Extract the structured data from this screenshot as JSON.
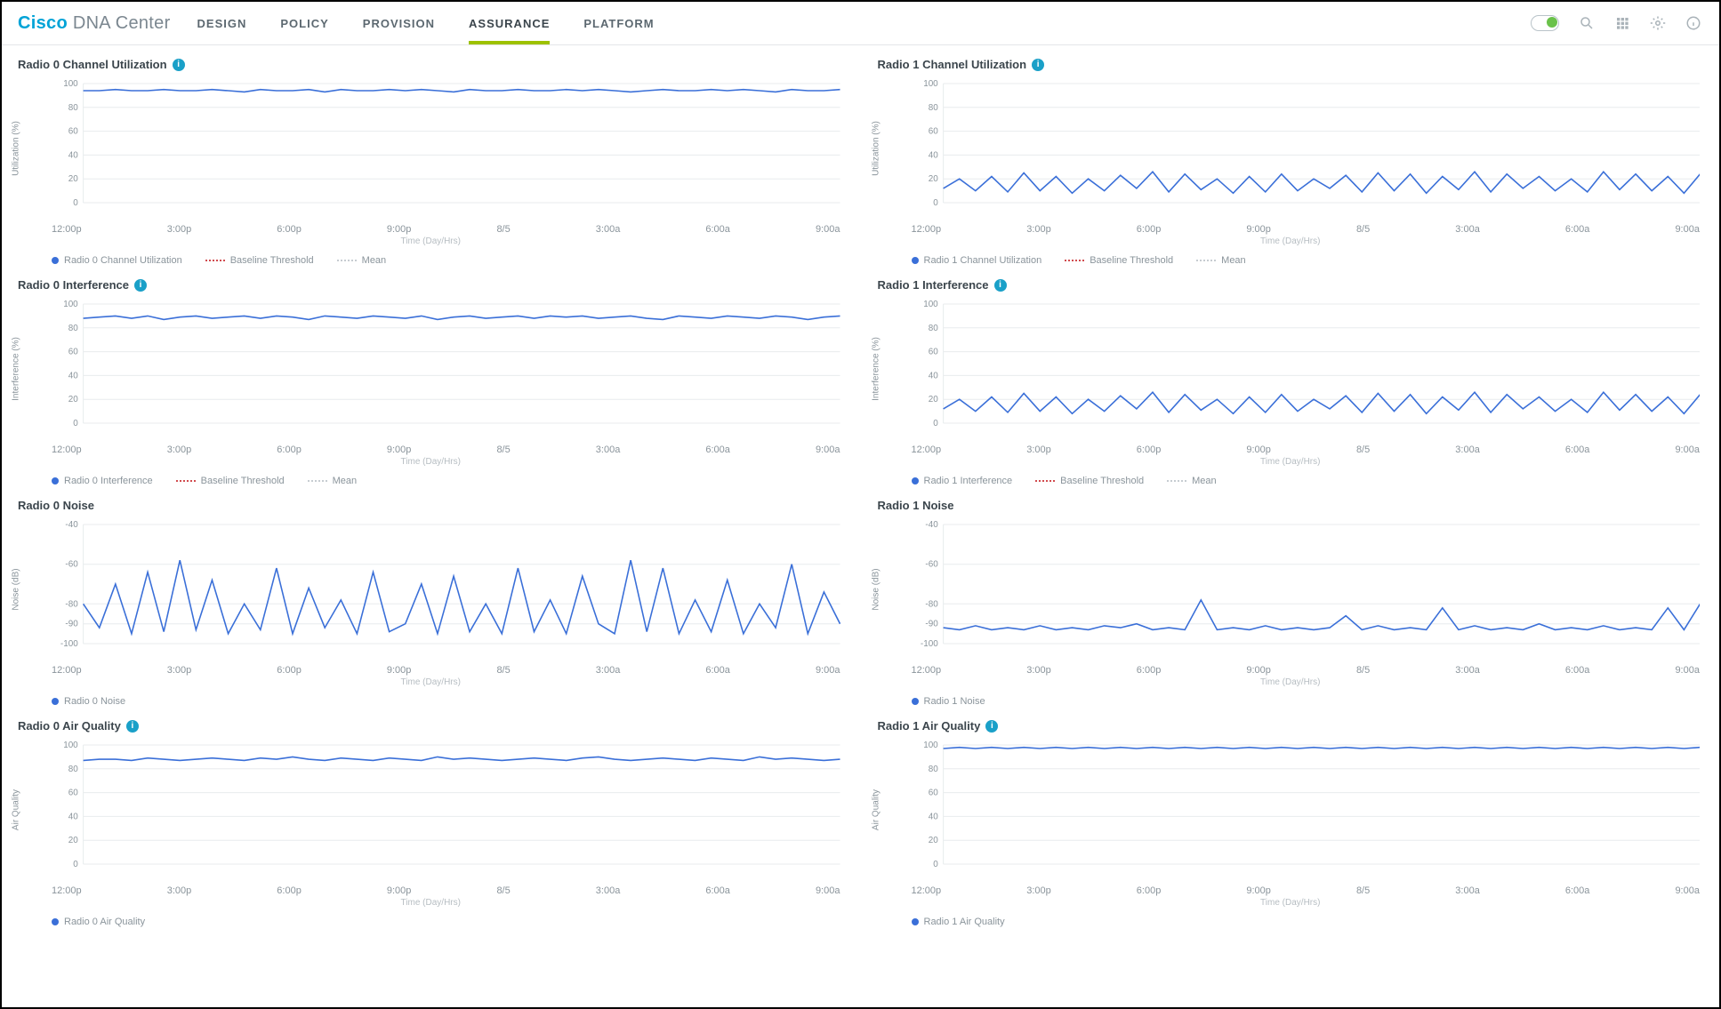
{
  "brand": {
    "cisco": "Cisco",
    "dna": " DNA Center"
  },
  "nav": [
    "DESIGN",
    "POLICY",
    "PROVISION",
    "ASSURANCE",
    "PLATFORM"
  ],
  "nav_active": 3,
  "xcats": [
    "12:00p",
    "3:00p",
    "6:00p",
    "9:00p",
    "8/5",
    "3:00a",
    "6:00a",
    "9:00a"
  ],
  "xaxis_title": "Time (Day/Hrs)",
  "legend": {
    "series": "",
    "baseline": "Baseline Threshold",
    "mean": "Mean"
  },
  "panels": [
    {
      "id": "r0-chan",
      "title": "Radio 0 Channel Utilization",
      "info": true,
      "ylabel": "Utilization (%)",
      "ylim": [
        0,
        100
      ],
      "legend_full": true,
      "series_name": "Radio 0 Channel Utilization"
    },
    {
      "id": "r1-chan",
      "title": "Radio 1 Channel Utilization",
      "info": true,
      "ylabel": "Utilization (%)",
      "ylim": [
        0,
        100
      ],
      "legend_full": true,
      "series_name": "Radio 1 Channel Utilization"
    },
    {
      "id": "r0-intf",
      "title": "Radio 0 Interference",
      "info": true,
      "ylabel": "Interference (%)",
      "ylim": [
        0,
        100
      ],
      "legend_full": true,
      "series_name": "Radio 0 Interference"
    },
    {
      "id": "r1-intf",
      "title": "Radio 1 Interference",
      "info": true,
      "ylabel": "Interference (%)",
      "ylim": [
        0,
        100
      ],
      "legend_full": true,
      "series_name": "Radio 1 Interference"
    },
    {
      "id": "r0-noise",
      "title": "Radio 0 Noise",
      "info": false,
      "ylabel": "Noise (dB)",
      "ylim": [
        -100,
        -40
      ],
      "legend_full": false,
      "series_name": "Radio 0 Noise"
    },
    {
      "id": "r1-noise",
      "title": "Radio 1 Noise",
      "info": false,
      "ylabel": "Noise (dB)",
      "ylim": [
        -100,
        -40
      ],
      "legend_full": false,
      "series_name": "Radio 1 Noise"
    },
    {
      "id": "r0-airq",
      "title": "Radio 0 Air Quality",
      "info": true,
      "ylabel": "Air Quality",
      "ylim": [
        0,
        100
      ],
      "legend_full": false,
      "series_name": "Radio 0 Air Quality"
    },
    {
      "id": "r1-airq",
      "title": "Radio 1 Air Quality",
      "info": true,
      "ylabel": "Air Quality",
      "ylim": [
        0,
        100
      ],
      "legend_full": false,
      "series_name": "Radio 1 Air Quality"
    }
  ],
  "chart_data": [
    {
      "panel": "r0-chan",
      "type": "line",
      "xlabel": "Time (Day/Hrs)",
      "ylabel": "Utilization (%)",
      "ylim": [
        0,
        100
      ],
      "yticks": [
        0,
        20,
        40,
        60,
        80,
        100
      ],
      "values": [
        94,
        94,
        95,
        94,
        94,
        95,
        94,
        94,
        95,
        94,
        93,
        95,
        94,
        94,
        95,
        93,
        95,
        94,
        94,
        95,
        94,
        95,
        94,
        93,
        95,
        94,
        94,
        95,
        94,
        94,
        95,
        94,
        95,
        94,
        93,
        94,
        95,
        94,
        94,
        95,
        94,
        95,
        94,
        93,
        95,
        94,
        94,
        95
      ]
    },
    {
      "panel": "r1-chan",
      "type": "line",
      "xlabel": "Time (Day/Hrs)",
      "ylabel": "Utilization (%)",
      "ylim": [
        0,
        100
      ],
      "yticks": [
        0,
        20,
        40,
        60,
        80,
        100
      ],
      "values": [
        12,
        20,
        10,
        22,
        9,
        25,
        10,
        22,
        8,
        20,
        10,
        23,
        12,
        26,
        9,
        24,
        11,
        20,
        8,
        22,
        9,
        24,
        10,
        20,
        12,
        23,
        9,
        25,
        10,
        24,
        8,
        22,
        11,
        26,
        9,
        24,
        12,
        22,
        10,
        20,
        9,
        26,
        11,
        24,
        10,
        22,
        8,
        24
      ]
    },
    {
      "panel": "r0-intf",
      "type": "line",
      "xlabel": "Time (Day/Hrs)",
      "ylabel": "Interference (%)",
      "ylim": [
        0,
        100
      ],
      "yticks": [
        0,
        20,
        40,
        60,
        80,
        100
      ],
      "values": [
        88,
        89,
        90,
        88,
        90,
        87,
        89,
        90,
        88,
        89,
        90,
        88,
        90,
        89,
        87,
        90,
        89,
        88,
        90,
        89,
        88,
        90,
        87,
        89,
        90,
        88,
        89,
        90,
        88,
        90,
        89,
        90,
        88,
        89,
        90,
        88,
        87,
        90,
        89,
        88,
        90,
        89,
        88,
        90,
        89,
        87,
        89,
        90
      ]
    },
    {
      "panel": "r1-intf",
      "type": "line",
      "xlabel": "Time (Day/Hrs)",
      "ylabel": "Interference (%)",
      "ylim": [
        0,
        100
      ],
      "yticks": [
        0,
        20,
        40,
        60,
        80,
        100
      ],
      "values": [
        12,
        20,
        10,
        22,
        9,
        25,
        10,
        22,
        8,
        20,
        10,
        23,
        12,
        26,
        9,
        24,
        11,
        20,
        8,
        22,
        9,
        24,
        10,
        20,
        12,
        23,
        9,
        25,
        10,
        24,
        8,
        22,
        11,
        26,
        9,
        24,
        12,
        22,
        10,
        20,
        9,
        26,
        11,
        24,
        10,
        22,
        8,
        24
      ]
    },
    {
      "panel": "r0-noise",
      "type": "line",
      "xlabel": "Time (Day/Hrs)",
      "ylabel": "Noise (dB)",
      "ylim": [
        -100,
        -40
      ],
      "yticks": [
        -100,
        -90,
        -80,
        -60,
        -40
      ],
      "values": [
        -80,
        -92,
        -70,
        -95,
        -64,
        -94,
        -58,
        -93,
        -68,
        -95,
        -80,
        -93,
        -62,
        -95,
        -72,
        -92,
        -78,
        -95,
        -64,
        -94,
        -90,
        -70,
        -95,
        -66,
        -94,
        -80,
        -95,
        -62,
        -94,
        -78,
        -95,
        -66,
        -90,
        -95,
        -58,
        -94,
        -62,
        -95,
        -78,
        -94,
        -68,
        -95,
        -80,
        -92,
        -60,
        -95,
        -74,
        -90
      ]
    },
    {
      "panel": "r1-noise",
      "type": "line",
      "xlabel": "Time (Day/Hrs)",
      "ylabel": "Noise (dB)",
      "ylim": [
        -100,
        -40
      ],
      "yticks": [
        -100,
        -90,
        -80,
        -60,
        -40
      ],
      "values": [
        -92,
        -93,
        -91,
        -93,
        -92,
        -93,
        -91,
        -93,
        -92,
        -93,
        -91,
        -92,
        -90,
        -93,
        -92,
        -93,
        -78,
        -93,
        -92,
        -93,
        -91,
        -93,
        -92,
        -93,
        -92,
        -86,
        -93,
        -91,
        -93,
        -92,
        -93,
        -82,
        -93,
        -91,
        -93,
        -92,
        -93,
        -90,
        -93,
        -92,
        -93,
        -91,
        -93,
        -92,
        -93,
        -82,
        -93,
        -80
      ]
    },
    {
      "panel": "r0-airq",
      "type": "line",
      "xlabel": "Time (Day/Hrs)",
      "ylabel": "Air Quality",
      "ylim": [
        0,
        100
      ],
      "yticks": [
        0,
        20,
        40,
        60,
        80,
        100
      ],
      "values": [
        87,
        88,
        88,
        87,
        89,
        88,
        87,
        88,
        89,
        88,
        87,
        89,
        88,
        90,
        88,
        87,
        89,
        88,
        87,
        89,
        88,
        87,
        90,
        88,
        89,
        88,
        87,
        88,
        89,
        88,
        87,
        89,
        90,
        88,
        87,
        88,
        89,
        88,
        87,
        89,
        88,
        87,
        90,
        88,
        89,
        88,
        87,
        88
      ]
    },
    {
      "panel": "r1-airq",
      "type": "line",
      "xlabel": "Time (Day/Hrs)",
      "ylabel": "Air Quality",
      "ylim": [
        0,
        100
      ],
      "yticks": [
        0,
        20,
        40,
        60,
        80,
        100
      ],
      "values": [
        97,
        98,
        97,
        98,
        97,
        98,
        97,
        98,
        97,
        98,
        97,
        98,
        97,
        98,
        97,
        98,
        97,
        98,
        97,
        98,
        97,
        98,
        97,
        98,
        97,
        98,
        97,
        98,
        97,
        98,
        97,
        98,
        97,
        98,
        97,
        98,
        97,
        98,
        97,
        98,
        97,
        98,
        97,
        98,
        97,
        98,
        97,
        98
      ]
    }
  ]
}
